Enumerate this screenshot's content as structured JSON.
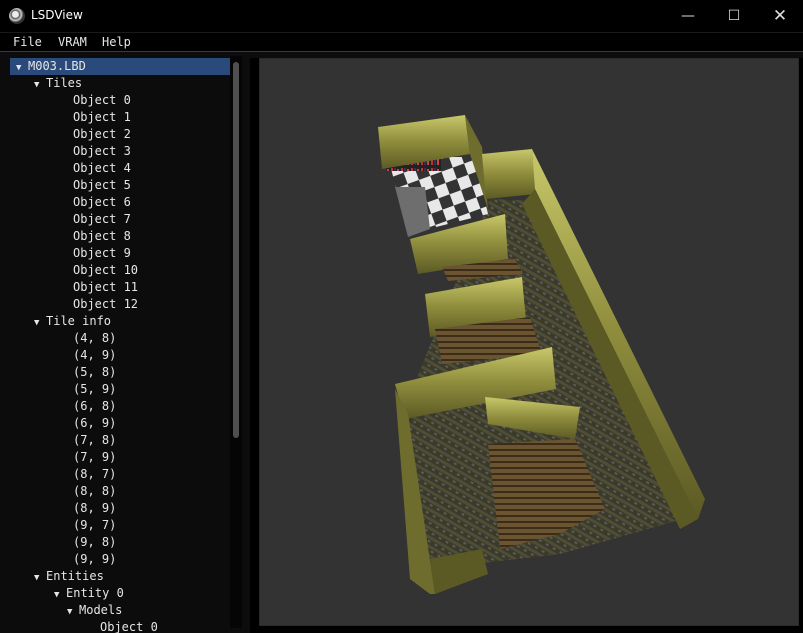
{
  "window": {
    "title": "LSDView",
    "minimize_glyph": "—",
    "maximize_glyph": "☐",
    "close_glyph": "✕"
  },
  "menu": [
    "File",
    "VRAM",
    "Help"
  ],
  "tree": [
    {
      "label": "M003.LBD",
      "depth": 0,
      "arrow": "▼",
      "selected": true
    },
    {
      "label": "Tiles",
      "depth": 1,
      "arrow": "▼"
    },
    {
      "label": "Object 0",
      "depth": 3
    },
    {
      "label": "Object 1",
      "depth": 3
    },
    {
      "label": "Object 2",
      "depth": 3
    },
    {
      "label": "Object 3",
      "depth": 3
    },
    {
      "label": "Object 4",
      "depth": 3
    },
    {
      "label": "Object 5",
      "depth": 3
    },
    {
      "label": "Object 6",
      "depth": 3
    },
    {
      "label": "Object 7",
      "depth": 3
    },
    {
      "label": "Object 8",
      "depth": 3
    },
    {
      "label": "Object 9",
      "depth": 3
    },
    {
      "label": "Object 10",
      "depth": 3
    },
    {
      "label": "Object 11",
      "depth": 3
    },
    {
      "label": "Object 12",
      "depth": 3
    },
    {
      "label": "Tile info",
      "depth": 1,
      "arrow": "▼"
    },
    {
      "label": "(4, 8)",
      "depth": 3
    },
    {
      "label": "(4, 9)",
      "depth": 3
    },
    {
      "label": "(5, 8)",
      "depth": 3
    },
    {
      "label": "(5, 9)",
      "depth": 3
    },
    {
      "label": "(6, 8)",
      "depth": 3
    },
    {
      "label": "(6, 9)",
      "depth": 3
    },
    {
      "label": "(7, 8)",
      "depth": 3
    },
    {
      "label": "(7, 9)",
      "depth": 3
    },
    {
      "label": "(8, 7)",
      "depth": 3
    },
    {
      "label": "(8, 8)",
      "depth": 3
    },
    {
      "label": "(8, 9)",
      "depth": 3
    },
    {
      "label": "(9, 7)",
      "depth": 3
    },
    {
      "label": "(9, 8)",
      "depth": 3
    },
    {
      "label": "(9, 9)",
      "depth": 3
    },
    {
      "label": "Entities",
      "depth": 1,
      "arrow": "▼"
    },
    {
      "label": "Entity 0",
      "depth": 2,
      "arrow": "▼"
    },
    {
      "label": "Models",
      "depth": 3,
      "arrow": "▼"
    },
    {
      "label": "Object 0",
      "depth": 4
    }
  ],
  "colors": {
    "selection": "#294a7a",
    "viewport_bg": "#333333",
    "wall": "#8a8a2e",
    "floor_dark": "#3c3a28"
  }
}
